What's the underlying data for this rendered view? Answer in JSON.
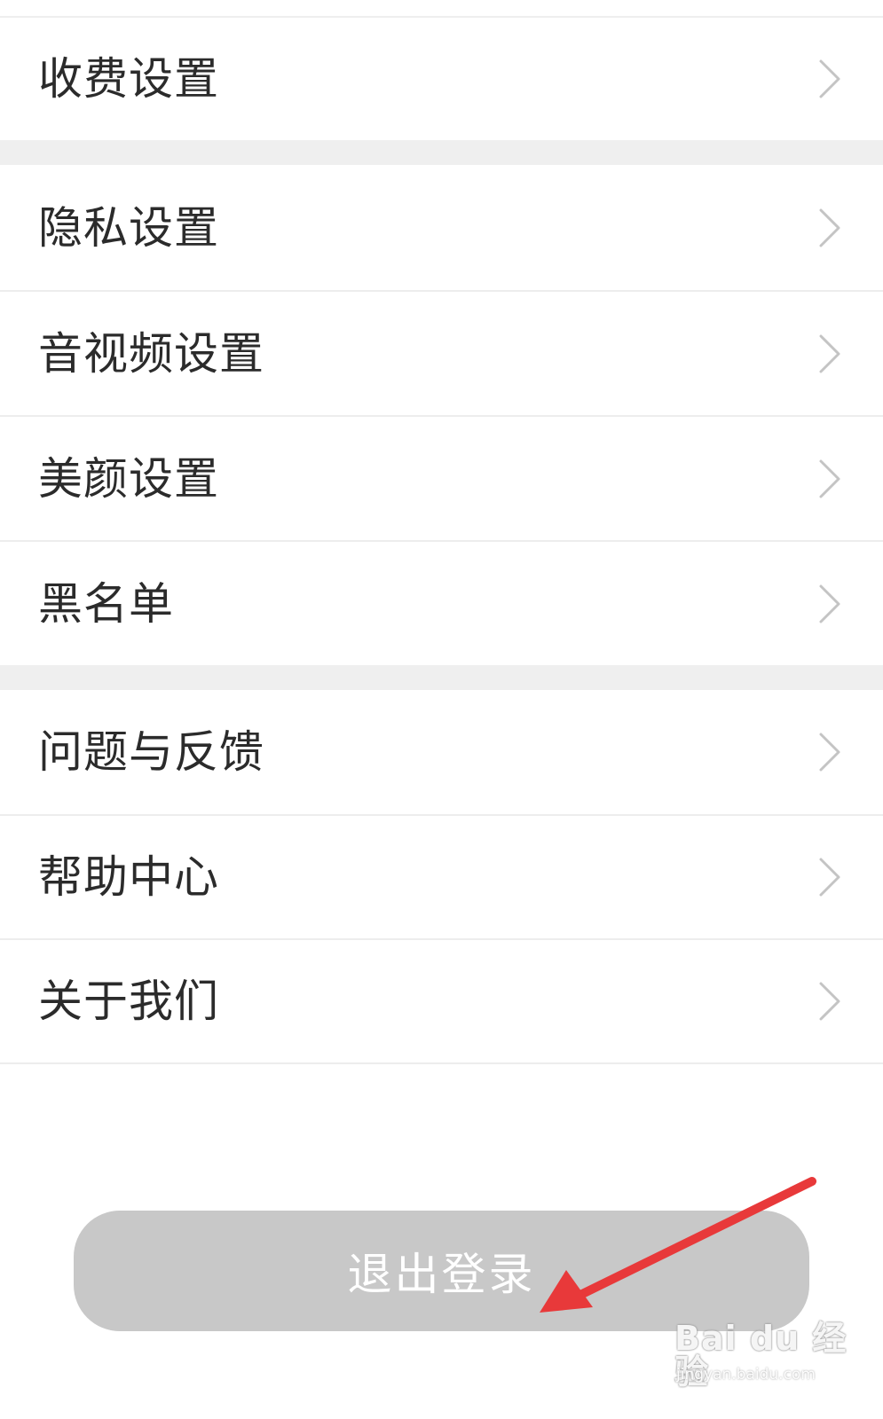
{
  "group1": [
    {
      "label": "收费设置",
      "name": "menu-item-fee-settings"
    }
  ],
  "group2": [
    {
      "label": "隐私设置",
      "name": "menu-item-privacy-settings"
    },
    {
      "label": "音视频设置",
      "name": "menu-item-av-settings"
    },
    {
      "label": "美颜设置",
      "name": "menu-item-beauty-settings"
    },
    {
      "label": "黑名单",
      "name": "menu-item-blacklist"
    }
  ],
  "group3": [
    {
      "label": "问题与反馈",
      "name": "menu-item-feedback"
    },
    {
      "label": "帮助中心",
      "name": "menu-item-help-center"
    },
    {
      "label": "关于我们",
      "name": "menu-item-about-us"
    }
  ],
  "logout_label": "退出登录",
  "watermark": {
    "main": "Bai du 经验",
    "sub": "jingyan.baidu.com"
  },
  "colors": {
    "arrow": "#e8393a",
    "logout_bg": "#c8c8c8",
    "divider": "#efefef"
  },
  "icons": {
    "chevron": "chevron-right-icon",
    "annotation": "red-arrow-annotation"
  }
}
